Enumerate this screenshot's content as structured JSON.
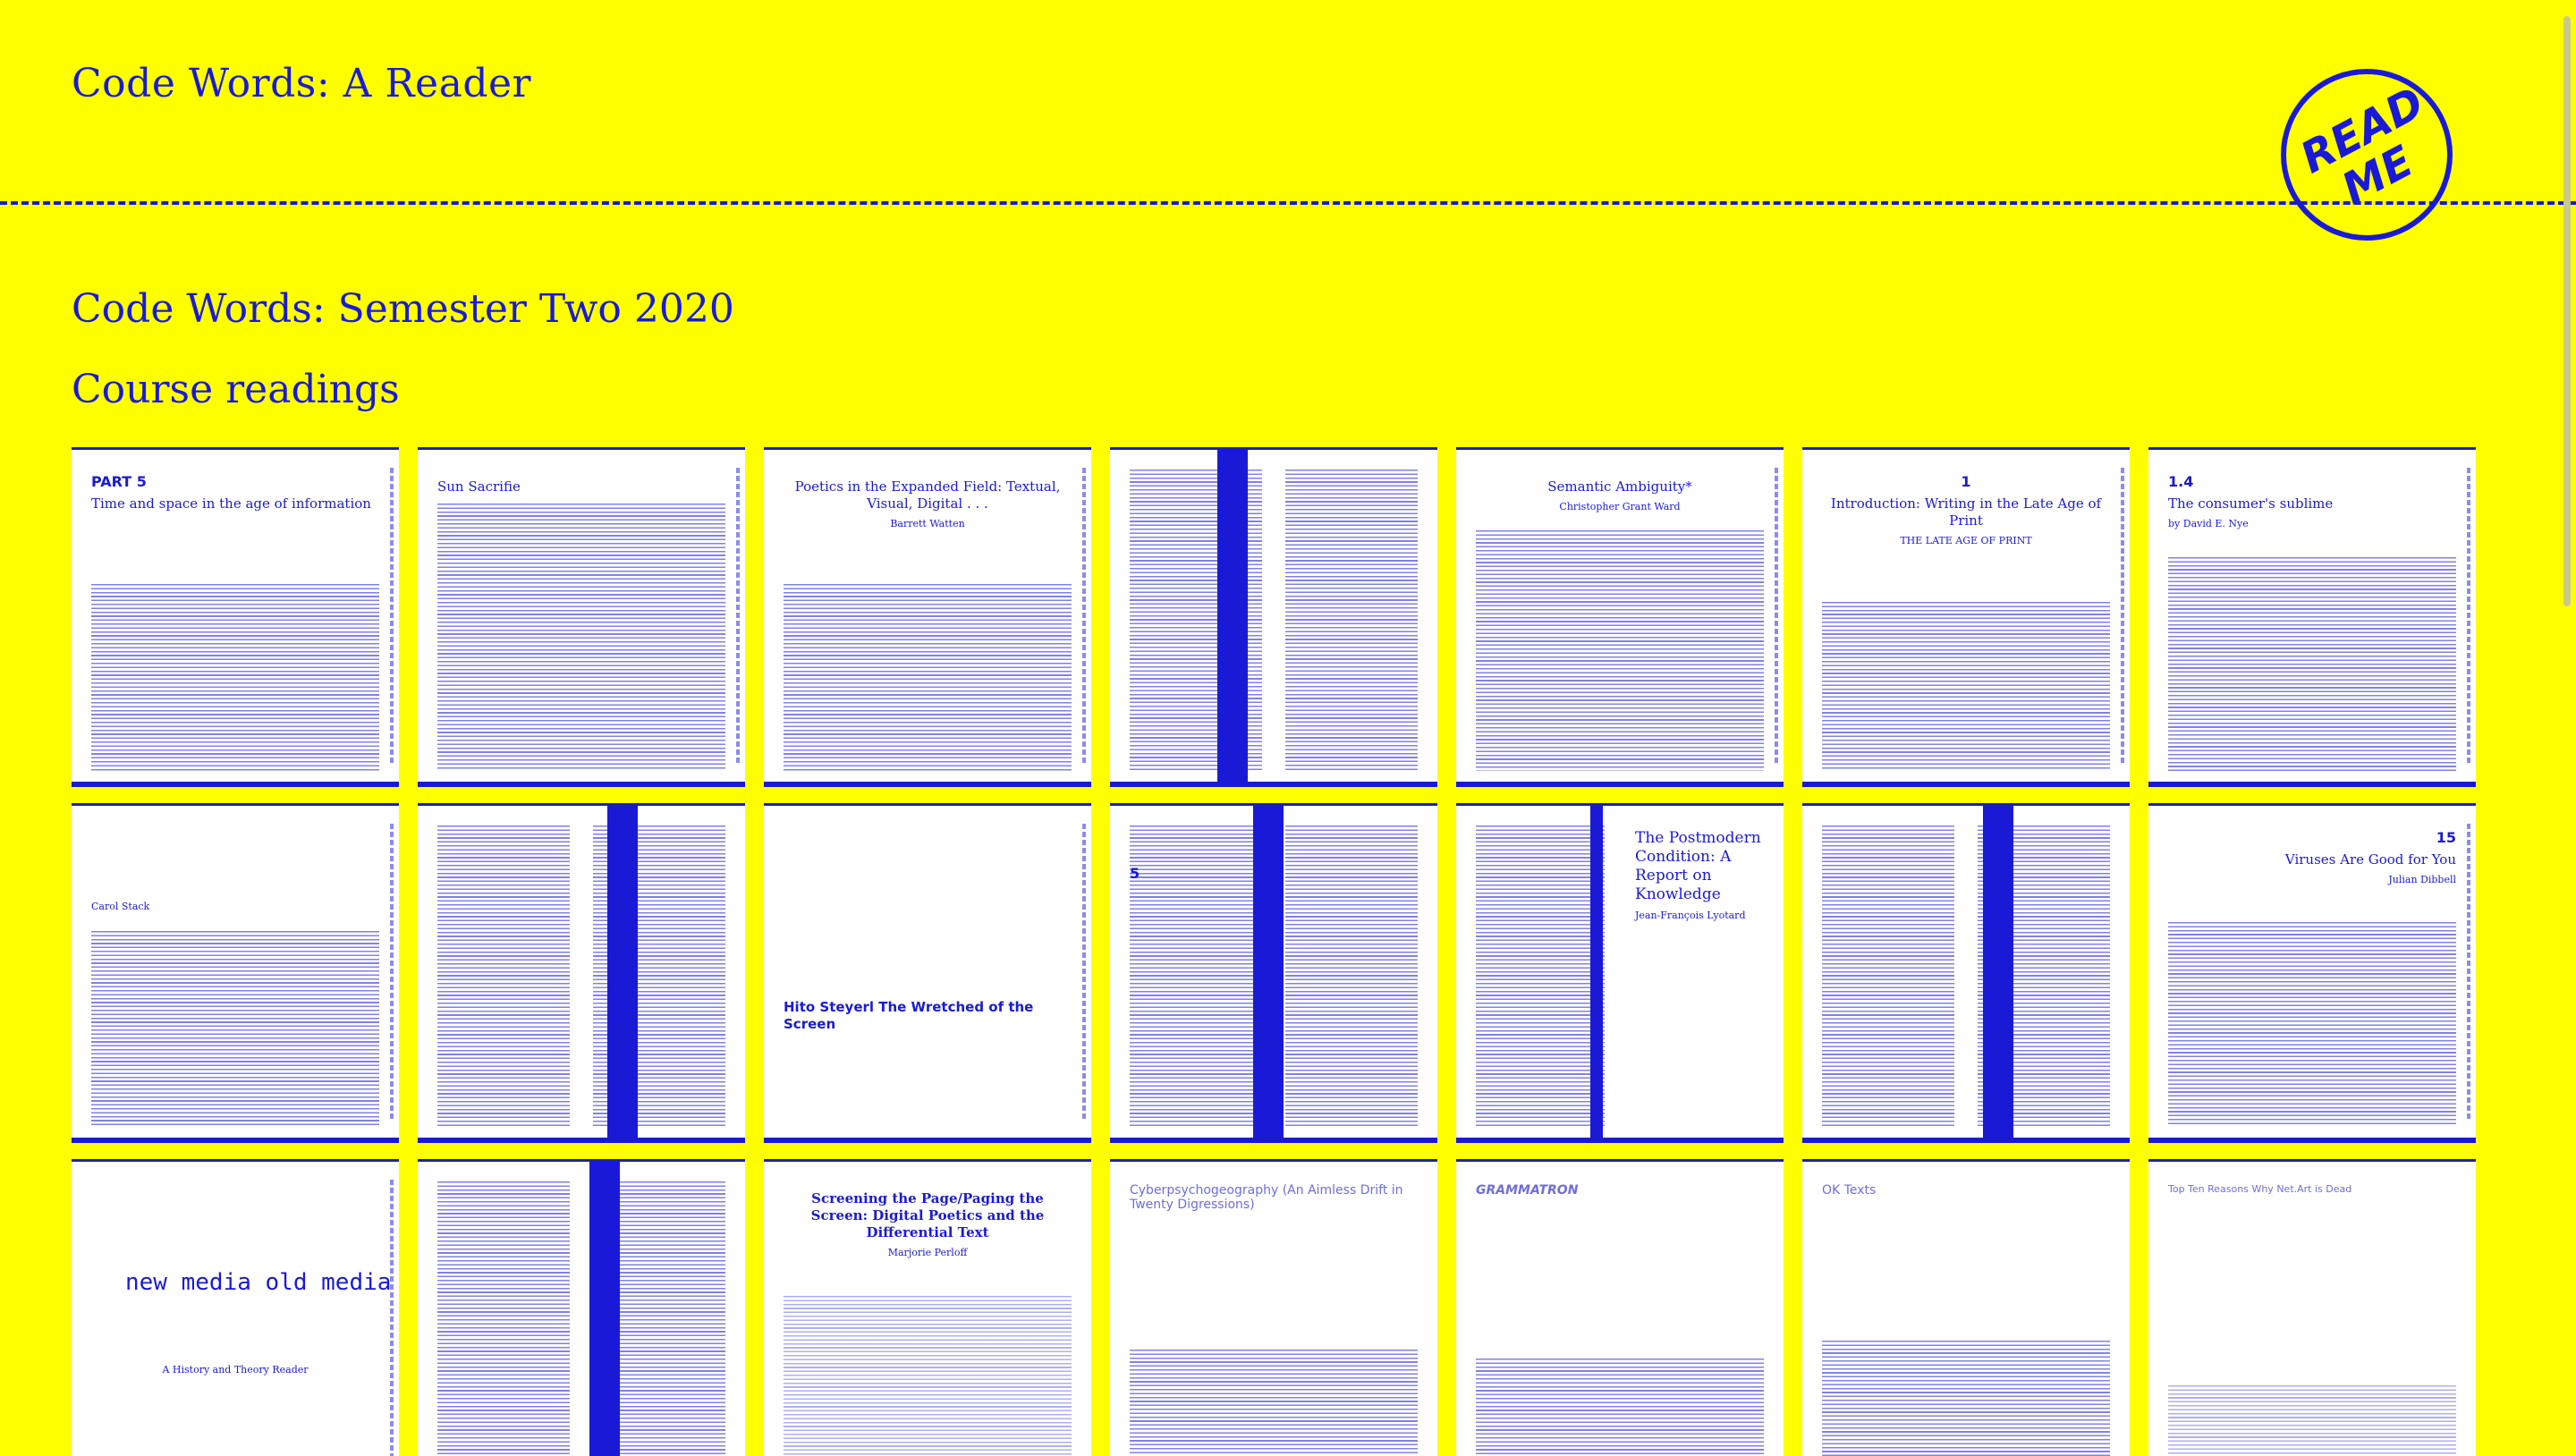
{
  "site": {
    "title": "Code Words: A Reader",
    "badge": "READ ME"
  },
  "main": {
    "semester_title": "Code Words: Semester Two 2020",
    "section_title": "Course readings"
  },
  "readings": [
    {
      "kicker": "PART 5",
      "title": "Time and space in the age of information",
      "sub": ""
    },
    {
      "kicker": "",
      "title": "Sun Sacrifie",
      "sub": ""
    },
    {
      "kicker": "",
      "title": "Poetics in the Expanded Field: Textual, Visual, Digital . . .",
      "sub": "Barrett Watten"
    },
    {
      "kicker": "",
      "title": "",
      "sub": ""
    },
    {
      "kicker": "",
      "title": "Semantic Ambiguity*",
      "sub": "Christopher Grant Ward"
    },
    {
      "kicker": "1",
      "title": "Introduction: Writing in the Late Age of Print",
      "sub": "THE LATE AGE OF PRINT"
    },
    {
      "kicker": "1.4",
      "title": "The consumer's sublime",
      "sub": "by David E. Nye"
    },
    {
      "kicker": "",
      "title": "",
      "sub": "Carol Stack"
    },
    {
      "kicker": "",
      "title": "",
      "sub": ""
    },
    {
      "kicker": "",
      "title": "Hito Steyerl The Wretched of the Screen",
      "sub": ""
    },
    {
      "kicker": "5",
      "title": "",
      "sub": ""
    },
    {
      "kicker": "",
      "title": "The Postmodern Condition: A Report on Knowledge",
      "sub": "Jean-François Lyotard"
    },
    {
      "kicker": "",
      "title": "",
      "sub": ""
    },
    {
      "kicker": "15",
      "title": "Viruses Are Good for You",
      "sub": "Julian Dibbell"
    },
    {
      "kicker": "",
      "title": "new media old media",
      "sub": "A History and Theory Reader"
    },
    {
      "kicker": "",
      "title": "",
      "sub": ""
    },
    {
      "kicker": "",
      "title": "Screening the Page/Paging the Screen: Digital Poetics and the Differential Text",
      "sub": "Marjorie Perloff"
    },
    {
      "kicker": "",
      "title": "Cyberpsychogeography (An Aimless Drift in Twenty Digressions)",
      "sub": ""
    },
    {
      "kicker": "",
      "title": "GRAMMATRON",
      "sub": ""
    },
    {
      "kicker": "",
      "title": "OK Texts",
      "sub": ""
    },
    {
      "kicker": "",
      "title": "Top Ten Reasons Why Net.Art is Dead",
      "sub": ""
    }
  ]
}
